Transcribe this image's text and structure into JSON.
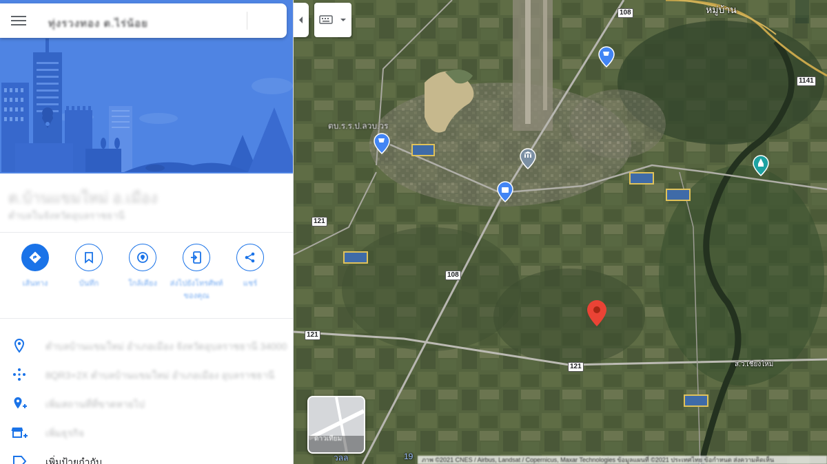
{
  "search": {
    "query": "ทุ่งรวงทอง ต.ไร่น้อย"
  },
  "place": {
    "title": "ต.บ้านแขมใหม่ อ.เมือง",
    "subtitle": "ตำบลในจังหวัดอุบลราชธานี"
  },
  "actions": [
    {
      "label": "เส้นทาง",
      "icon": "directions-icon"
    },
    {
      "label": "บันทึก",
      "icon": "bookmark-icon"
    },
    {
      "label": "ใกล้เคียง",
      "icon": "nearby-icon"
    },
    {
      "label": "ส่งไปยังโทรศัพท์ของคุณ",
      "icon": "send-to-phone-icon"
    },
    {
      "label": "แชร์",
      "icon": "share-icon"
    }
  ],
  "info_rows": [
    {
      "icon": "location-pin-icon",
      "text": "ตำบลบ้านแขมใหม่ อำเภอเมือง จังหวัดอุบลราชธานี 34000"
    },
    {
      "icon": "plus-code-icon",
      "text": "8QR3+2X ตำบลบ้านแขมใหม่ อำเภอเมือง อุบลราชธานี"
    },
    {
      "icon": "add-place-icon",
      "text": "เพิ่มสถานที่ที่ขาดหายไป"
    },
    {
      "icon": "add-business-icon",
      "text": "เพิ่มธุรกิจ"
    },
    {
      "icon": "label-icon",
      "text": "เพิ่มป้ายกำกับ"
    }
  ],
  "map": {
    "road_shields": [
      "108",
      "1141",
      "121",
      "108",
      "121",
      "121"
    ],
    "labels": {
      "village_top": "หมู่บ้าน",
      "district_left": "ตบ.ร.ร.ป.ลวบ.วร",
      "road_right": "ส.ว.เชียงใหม่",
      "bottom_left": "วลล",
      "bottom_num": "19"
    },
    "layer_label": "ดาวเทียม",
    "attribution": "ภาพ ©2021 CNES / Airbus, Landsat / Copernicus, Maxar Technologies ข้อมูลแผนที่ ©2021 ประเทศไทย ข้อกำหนด ส่งความคิดเห็น"
  },
  "colors": {
    "accent": "#1a73e8",
    "hero_bg": "#4a7fe0",
    "pin_red": "#ea4335",
    "map_green": "#4a5a3c"
  }
}
